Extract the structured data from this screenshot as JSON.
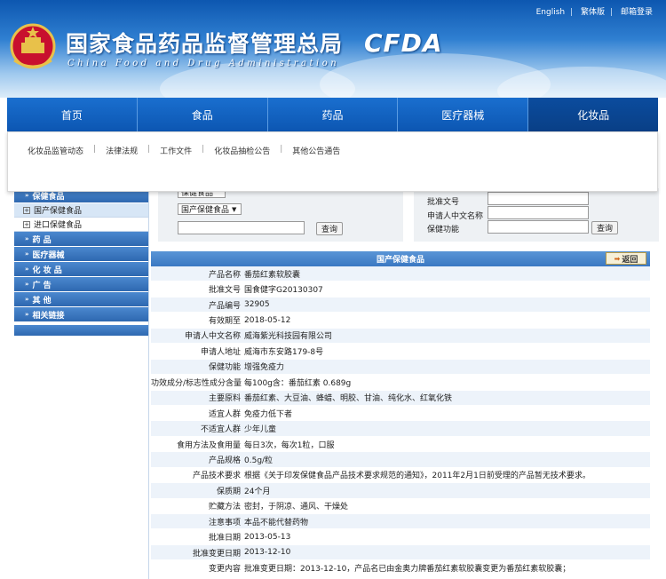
{
  "header": {
    "links": [
      "English",
      "繁体版",
      "邮箱登录"
    ],
    "title": "国家食品药品监督管理总局",
    "subtitle": "China Food and Drug Administration",
    "logo_text": "CFDA"
  },
  "nav": {
    "items": [
      "首页",
      "食品",
      "药品",
      "医疗器械",
      "化妆品"
    ]
  },
  "subnav": {
    "items": [
      "化妆品监管动态",
      "法律法规",
      "工作文件",
      "化妆品抽检公告",
      "其他公告通告"
    ]
  },
  "sidebar": {
    "health": "保健食品",
    "sub1": "国产保健食品",
    "sub2": "进口保健食品",
    "drug": "药 品",
    "device": "医疗器械",
    "cosmetic": "化 妆 品",
    "ad": "广 告",
    "other": "其 他",
    "links": "相关链接"
  },
  "search": {
    "select_top": "保健食品",
    "select_type": "国产保健食品",
    "query_btn": "查询",
    "label_approval": "批准文号",
    "label_applicant": "申请人中文名称",
    "label_function": "保健功能",
    "query_btn2": "查询"
  },
  "detail": {
    "title": "国产保健食品",
    "back": "返回",
    "rows": [
      {
        "label": "产品名称",
        "value": "番茄红素软胶囊"
      },
      {
        "label": "批准文号",
        "value": "国食健字G20130307"
      },
      {
        "label": "产品编号",
        "value": "32905"
      },
      {
        "label": "有效期至",
        "value": "2018-05-12"
      },
      {
        "label": "申请人中文名称",
        "value": "威海紫光科技园有限公司"
      },
      {
        "label": "申请人地址",
        "value": "威海市东安路179-8号"
      },
      {
        "label": "保健功能",
        "value": "增强免疫力"
      },
      {
        "label": "功效成分/标志性成分含量",
        "value": "每100g含：番茄红素 0.689g"
      },
      {
        "label": "主要原料",
        "value": "番茄红素、大豆油、蜂蜡、明胶、甘油、纯化水、红氧化铁"
      },
      {
        "label": "适宜人群",
        "value": "免疫力低下者"
      },
      {
        "label": "不适宜人群",
        "value": "少年儿童"
      },
      {
        "label": "食用方法及食用量",
        "value": "每日3次，每次1粒，口服"
      },
      {
        "label": "产品规格",
        "value": "0.5g/粒"
      },
      {
        "label": "产品技术要求",
        "value": "根据《关于印发保健食品产品技术要求规范的通知》，2011年2月1日前受理的产品暂无技术要求。"
      },
      {
        "label": "保质期",
        "value": "24个月"
      },
      {
        "label": "贮藏方法",
        "value": "密封，于阴凉、通风、干燥处"
      },
      {
        "label": "注意事项",
        "value": "本品不能代替药物"
      },
      {
        "label": "批准日期",
        "value": "2013-05-13"
      },
      {
        "label": "批准变更日期",
        "value": "2013-12-10"
      },
      {
        "label": "变更内容",
        "value": "批准变更日期：2013-12-10，产品名已由金奥力牌番茄红素软胶囊变更为番茄红素软胶囊；"
      }
    ]
  }
}
